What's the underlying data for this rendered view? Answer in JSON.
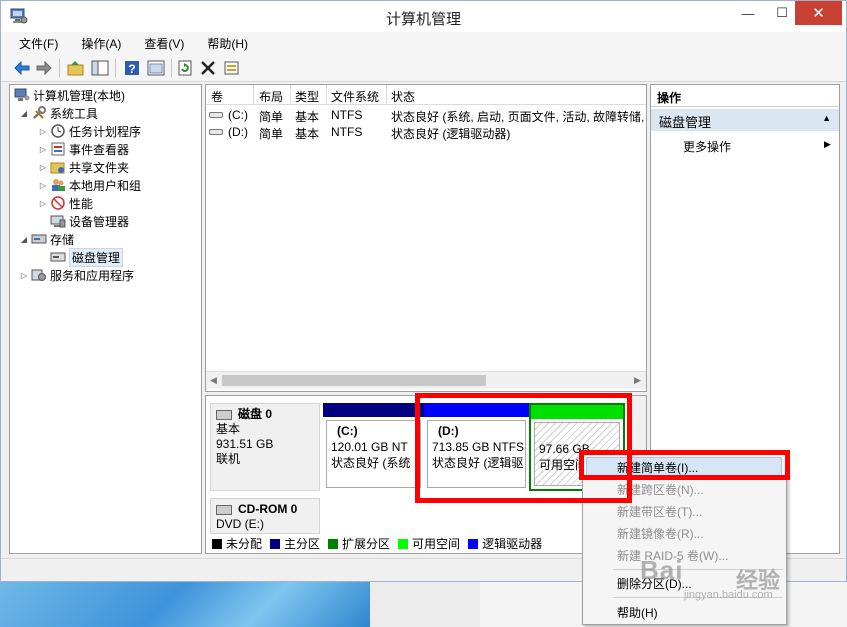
{
  "window": {
    "title": "计算机管理",
    "controls": {
      "minimize": "—",
      "maximize": "☐",
      "close": "✕"
    }
  },
  "menu": [
    "文件(F)",
    "操作(A)",
    "查看(V)",
    "帮助(H)"
  ],
  "toolbar": [
    "back-icon",
    "forward-icon",
    "up-folder-icon",
    "show-tree-icon",
    "help-icon",
    "properties-icon",
    "refresh-icon",
    "delete-icon",
    "export-icon"
  ],
  "tree": {
    "root": "计算机管理(本地)",
    "system_tools": "系统工具",
    "items": [
      "任务计划程序",
      "事件查看器",
      "共享文件夹",
      "本地用户和组",
      "性能",
      "设备管理器"
    ],
    "storage": "存储",
    "disk_management": "磁盘管理",
    "services": "服务和应用程序"
  },
  "volume_list": {
    "headers": [
      "卷",
      "布局",
      "类型",
      "文件系统",
      "状态"
    ],
    "rows": [
      {
        "volume": "(C:)",
        "layout": "简单",
        "type": "基本",
        "fs": "NTFS",
        "status": "状态良好 (系统, 启动, 页面文件, 活动, 故障转储,"
      },
      {
        "volume": "(D:)",
        "layout": "简单",
        "type": "基本",
        "fs": "NTFS",
        "status": "状态良好 (逻辑驱动器)"
      }
    ]
  },
  "disks": [
    {
      "name": "磁盘 0",
      "type": "基本",
      "size": "931.51 GB",
      "status": "联机",
      "partitions": [
        {
          "label": "(C:)",
          "size": "120.01 GB NT",
          "status": "状态良好 (系统",
          "bar_color": "#000080"
        },
        {
          "label": "(D:)",
          "size": "713.85 GB NTFS",
          "status": "状态良好 (逻辑驱",
          "bar_color": "#0000ff"
        },
        {
          "label": "",
          "size": "97.66 GB",
          "status": "可用空间",
          "bar_color": "#00e000"
        }
      ]
    },
    {
      "name": "CD-ROM 0",
      "type": "DVD (E:)"
    }
  ],
  "legend": [
    {
      "label": "未分配",
      "color": "#000000"
    },
    {
      "label": "主分区",
      "color": "#000080"
    },
    {
      "label": "扩展分区",
      "color": "#008000"
    },
    {
      "label": "可用空间",
      "color": "#00ff00"
    },
    {
      "label": "逻辑驱动器",
      "color": "#0000ff"
    }
  ],
  "actions": {
    "header": "操作",
    "section": "磁盘管理",
    "more": "更多操作"
  },
  "context_menu": [
    {
      "label": "新建简单卷(I)...",
      "enabled": true,
      "highlighted": true
    },
    {
      "label": "新建跨区卷(N)...",
      "enabled": false
    },
    {
      "label": "新建带区卷(T)...",
      "enabled": false
    },
    {
      "label": "新建镜像卷(R)...",
      "enabled": false
    },
    {
      "label": "新建 RAID-5 卷(W)...",
      "enabled": false
    },
    {
      "label": "删除分区(D)...",
      "enabled": true
    },
    {
      "label": "帮助(H)",
      "enabled": true
    }
  ],
  "watermark": {
    "logo": "Bai",
    "text": "经验",
    "url": "jingyan.baidu.com"
  }
}
